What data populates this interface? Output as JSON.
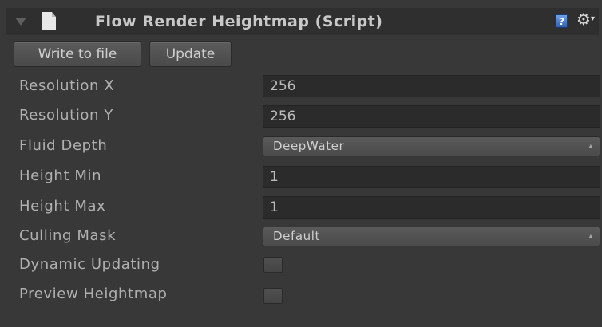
{
  "header": {
    "title": "Flow Render Heightmap (Script)",
    "help_glyph": "?",
    "icons": [
      "foldout-arrow-icon",
      "script-icon",
      "help-icon",
      "gear-icon"
    ]
  },
  "buttons": {
    "write_label": "Write to file",
    "update_label": "Update"
  },
  "properties": {
    "resolution_x": {
      "label": "Resolution X",
      "value": "256"
    },
    "resolution_y": {
      "label": "Resolution Y",
      "value": "256"
    },
    "fluid_depth": {
      "label": "Fluid Depth",
      "value": "DeepWater"
    },
    "height_min": {
      "label": "Height Min",
      "value": "1"
    },
    "height_max": {
      "label": "Height Max",
      "value": "1"
    },
    "culling_mask": {
      "label": "Culling Mask",
      "value": "Default"
    },
    "dynamic_updating": {
      "label": "Dynamic Updating",
      "checked": false
    },
    "preview_heightmap": {
      "label": "Preview Heightmap",
      "checked": false
    }
  },
  "colors": {
    "background": "#383838",
    "header_background": "#2f2f2f",
    "field_background": "#2b2b2b",
    "text": "#b4b4b4"
  }
}
